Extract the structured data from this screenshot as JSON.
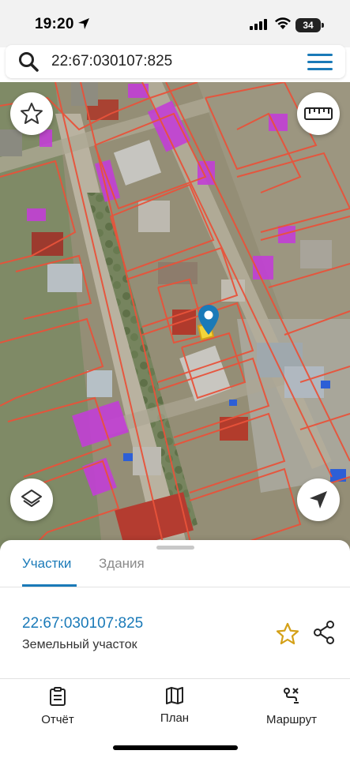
{
  "status_bar": {
    "time": "19:20",
    "battery": "34"
  },
  "search": {
    "query": "22:67:030107:825",
    "search_icon": "search-icon",
    "menu_icon": "hamburger-menu-icon"
  },
  "map": {
    "favorite_icon": "star-outline-icon",
    "ruler_icon": "ruler-icon",
    "layers_icon": "layers-icon",
    "location_icon": "navigation-arrow-icon",
    "pin_icon": "location-pin-icon",
    "colors": {
      "parcel_border": "#e8533a",
      "building_highlight": "#c040d8",
      "pin": "#1a7ab8"
    }
  },
  "sheet": {
    "tabs": [
      {
        "label": "Участки",
        "active": true
      },
      {
        "label": "Здания",
        "active": false
      }
    ],
    "parcel": {
      "number": "22:67:030107:825",
      "type": "Земельный участок"
    },
    "favorite_icon": "star-icon",
    "share_icon": "share-icon"
  },
  "bottom_nav": [
    {
      "label": "Отчёт",
      "icon": "report-clipboard-icon"
    },
    {
      "label": "План",
      "icon": "map-plan-icon"
    },
    {
      "label": "Маршрут",
      "icon": "route-icon"
    }
  ],
  "accent_color": "#1a7ab8"
}
